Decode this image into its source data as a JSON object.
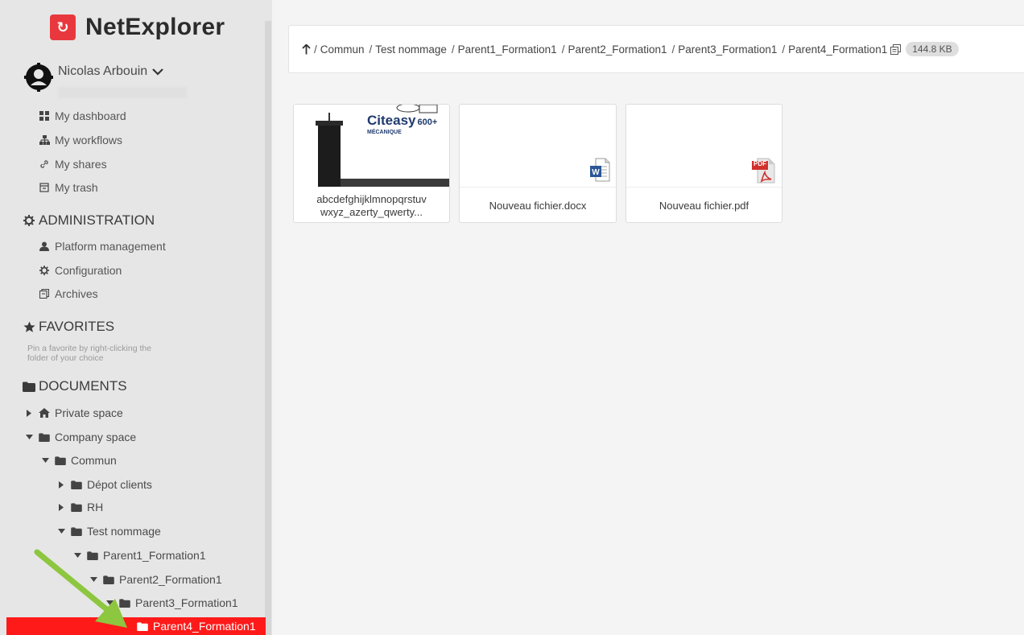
{
  "brand": {
    "name": "NetExplorer",
    "logo_glyph": "↻"
  },
  "user": {
    "name": "Nicolas Arbouin"
  },
  "nav": [
    {
      "label": "My dashboard"
    },
    {
      "label": "My workflows"
    },
    {
      "label": "My shares"
    },
    {
      "label": "My trash"
    }
  ],
  "admin": {
    "title": "ADMINISTRATION",
    "items": [
      {
        "label": "Platform management"
      },
      {
        "label": "Configuration"
      },
      {
        "label": "Archives"
      }
    ]
  },
  "favorites": {
    "title": "FAVORITES",
    "hint_line1": "Pin a favorite by right-clicking the",
    "hint_line2": "folder of your choice"
  },
  "documents": {
    "title": "DOCUMENTS",
    "tree": [
      {
        "label": "Private space",
        "expanded": false
      },
      {
        "label": "Company space",
        "expanded": true
      },
      {
        "label": "Commun",
        "expanded": true
      },
      {
        "label": "Dépot clients",
        "expanded": false
      },
      {
        "label": "RH",
        "expanded": false
      },
      {
        "label": "Test nommage",
        "expanded": true
      },
      {
        "label": "Parent1_Formation1",
        "expanded": true
      },
      {
        "label": "Parent2_Formation1",
        "expanded": true
      },
      {
        "label": "Parent3_Formation1",
        "expanded": true
      },
      {
        "label": "Parent4_Formation1",
        "active": true
      }
    ]
  },
  "breadcrumb": {
    "crumbs": [
      "Commun",
      "Test nommage",
      "Parent1_Formation1",
      "Parent2_Formation1",
      "Parent3_Formation1",
      "Parent4_Formation1"
    ],
    "size": "144.8 KB"
  },
  "files": [
    {
      "name_line1": "abcdefghijklmnopqrstuv",
      "name_line2": "wxyz_azerty_qwerty...",
      "thumb_brand": "Citeasy",
      "thumb_model": "600+",
      "thumb_sub": "MÉCANIQUE"
    },
    {
      "name": "Nouveau fichier.docx",
      "type": "word"
    },
    {
      "name": "Nouveau fichier.pdf",
      "type": "pdf",
      "badge": "PDF"
    }
  ],
  "colors": {
    "accent": "#ff1a1a",
    "brand_red": "#e8383d",
    "word_blue": "#2b5797",
    "arrow_green": "#8dc63f"
  }
}
